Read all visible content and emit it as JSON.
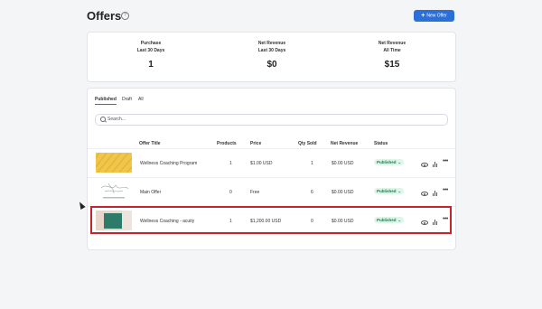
{
  "header": {
    "title": "Offers",
    "new_offer_label": "New Offer"
  },
  "stats": [
    {
      "label_line1": "Purchase",
      "label_line2": "Last 30 Days",
      "value": "1"
    },
    {
      "label_line1": "Net Revenue",
      "label_line2": "Last 30 Days",
      "value": "$0"
    },
    {
      "label_line1": "Net Revenue",
      "label_line2": "All Time",
      "value": "$15"
    }
  ],
  "tabs": [
    {
      "label": "Published"
    },
    {
      "label": "Draft"
    },
    {
      "label": "All"
    }
  ],
  "search": {
    "placeholder": "Search..."
  },
  "columns": {
    "offer_title": "Offer Title",
    "products": "Products",
    "price": "Price",
    "qty_sold": "Qty Sold",
    "net_revenue": "Net Revenue",
    "status": "Status"
  },
  "rows": [
    {
      "title": "Wellness Coaching Program",
      "products": "1",
      "price": "$1.00 USD",
      "qty_sold": "1",
      "net_revenue": "$0.00 USD",
      "status": "Published"
    },
    {
      "title": "Main Offer",
      "products": "0",
      "price": "Free",
      "qty_sold": "6",
      "net_revenue": "$0.00 USD",
      "status": "Published"
    },
    {
      "title": "Wellness Coaching - acuity",
      "products": "1",
      "price": "$1,200.00 USD",
      "qty_sold": "0",
      "net_revenue": "$0.00 USD",
      "status": "Published"
    }
  ],
  "colors": {
    "accent": "#2b6fd8",
    "status_bg": "#dff5ea",
    "status_text": "#1d7a4b",
    "highlight": "#c8232c"
  }
}
